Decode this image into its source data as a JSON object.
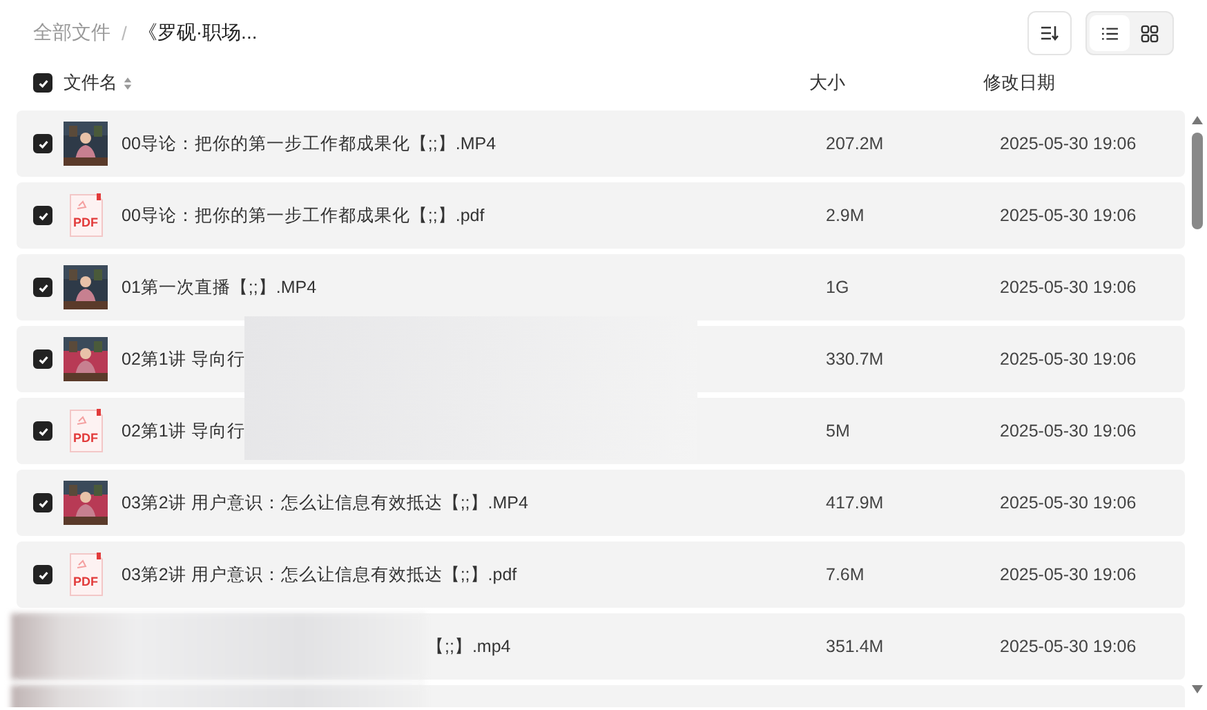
{
  "breadcrumb": [
    {
      "label": "全部文件",
      "kind": "link"
    },
    {
      "label": "《罗砚·职场...",
      "kind": "current"
    }
  ],
  "separator": "/",
  "view_toggle": [
    {
      "kind": "list",
      "selected": true
    },
    {
      "kind": "grid",
      "selected": false
    }
  ],
  "header": {
    "checked": true,
    "columns": [
      "文件名",
      "大小",
      "修改日期"
    ]
  },
  "rows": [
    {
      "kind": "video",
      "checked": true,
      "name": "00导论：把你的第一步工作都成果化【;;】.MP4",
      "size": "207.2M",
      "date": "2025-05-30 19:06"
    },
    {
      "kind": "pdf",
      "checked": true,
      "icon_label": "PDF",
      "name": "00导论：把你的第一步工作都成果化【;;】.pdf",
      "size": "2.9M",
      "date": "2025-05-30 19:06"
    },
    {
      "kind": "video",
      "checked": true,
      "name": "01第一次直播【;;】.MP4",
      "size": "1G",
      "date": "2025-05-30 19:06"
    },
    {
      "kind": "video",
      "checked": true,
      "name": "02第1讲 导向行",
      "size": "330.7M",
      "date": "2025-05-30 19:06"
    },
    {
      "kind": "pdf",
      "checked": true,
      "icon_label": "PDF",
      "name": "02第1讲 导向行",
      "size": "5M",
      "date": "2025-05-30 19:06"
    },
    {
      "kind": "video",
      "checked": true,
      "name": "03第2讲 用户意识：怎么让信息有效抵达【;;】.MP4",
      "size": "417.9M",
      "date": "2025-05-30 19:06"
    },
    {
      "kind": "pdf",
      "checked": true,
      "icon_label": "PDF",
      "name": "03第2讲 用户意识：怎么让信息有效抵达【;;】.pdf",
      "size": "7.6M",
      "date": "2025-05-30 19:06"
    },
    {
      "kind": "covered",
      "name": "【;;】.mp4",
      "size": "351.4M",
      "date": "2025-05-30 19:06"
    },
    {
      "kind": "covered-empty"
    }
  ]
}
